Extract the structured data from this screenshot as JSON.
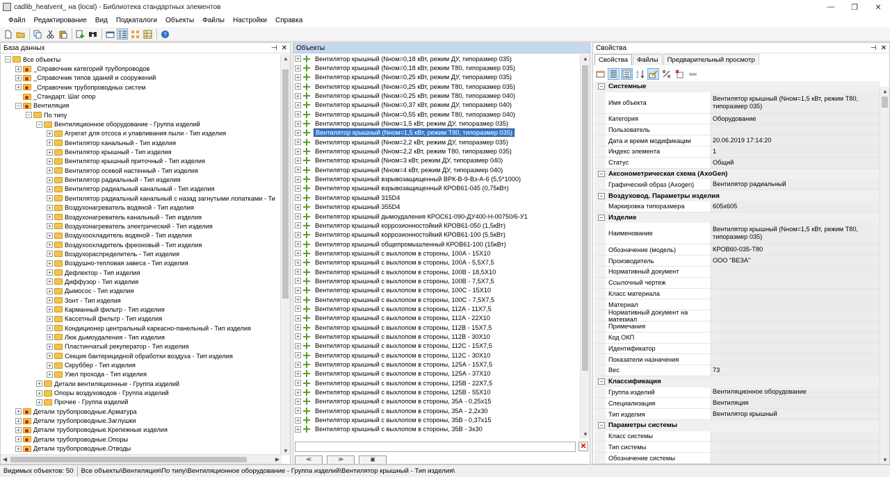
{
  "window": {
    "title": "cadlib_heatvent_ на (local)  - Библиотека стандартных элементов",
    "minimize": "—",
    "maximize": "❐",
    "close": "✕"
  },
  "menu": [
    "Файл",
    "Редактирование",
    "Вид",
    "Подкаталоги",
    "Объекты",
    "Файлы",
    "Настройки",
    "Справка"
  ],
  "database_pane": {
    "title": "База данных",
    "pin": "⊣",
    "close": "✕",
    "tree": [
      {
        "label": "Все объекты",
        "level": 0,
        "exp": "−",
        "cat": false
      },
      {
        "label": "_Справочник категорий трубопроводов",
        "level": 1,
        "exp": "+",
        "cat": true
      },
      {
        "label": "_Справочник типов зданий и сооружений",
        "level": 1,
        "exp": "+",
        "cat": true
      },
      {
        "label": "_Справочник трубопроводных систем",
        "level": 1,
        "exp": "+",
        "cat": true
      },
      {
        "label": "_Стандарт. Шаг опор",
        "level": 1,
        "exp": "",
        "cat": true
      },
      {
        "label": "Вентиляция",
        "level": 1,
        "exp": "−",
        "cat": true
      },
      {
        "label": "По типу",
        "level": 2,
        "exp": "−",
        "cat": false
      },
      {
        "label": "Вентиляционное оборудование - Группа изделий",
        "level": 3,
        "exp": "−",
        "cat": false
      },
      {
        "label": "Агрегат для отсоса и улавливания пыли - Тип изделия",
        "level": 4,
        "exp": "+",
        "cat": false
      },
      {
        "label": "Вентилятор канальный - Тип изделия",
        "level": 4,
        "exp": "+",
        "cat": false
      },
      {
        "label": "Вентилятор крышный - Тип изделия",
        "level": 4,
        "exp": "+",
        "cat": false
      },
      {
        "label": "Вентилятор крышный приточный - Тип изделия",
        "level": 4,
        "exp": "+",
        "cat": false
      },
      {
        "label": "Вентилятор осевой настенный - Тип изделия",
        "level": 4,
        "exp": "+",
        "cat": false
      },
      {
        "label": "Вентилятор радиальный - Тип изделия",
        "level": 4,
        "exp": "+",
        "cat": false
      },
      {
        "label": "Вентилятор радиальный канальный - Тип изделия",
        "level": 4,
        "exp": "+",
        "cat": false
      },
      {
        "label": "Вентилятор радиальный канальный с назад загнутыми лопатками - Ти",
        "level": 4,
        "exp": "+",
        "cat": false
      },
      {
        "label": "Воздухонагреватель водяной - Тип изделия",
        "level": 4,
        "exp": "+",
        "cat": false
      },
      {
        "label": "Воздухонагреватель канальный - Тип изделия",
        "level": 4,
        "exp": "+",
        "cat": false
      },
      {
        "label": "Воздухонагреватель электрический - Тип изделия",
        "level": 4,
        "exp": "+",
        "cat": false
      },
      {
        "label": "Воздухоохладитель водяной - Тип изделия",
        "level": 4,
        "exp": "+",
        "cat": false
      },
      {
        "label": "Воздухоохладитель фреоновый - Тип изделия",
        "level": 4,
        "exp": "+",
        "cat": false
      },
      {
        "label": "Воздухораспределитель - Тип изделия",
        "level": 4,
        "exp": "+",
        "cat": false
      },
      {
        "label": "Воздушно-тепловая завеса - Тип изделия",
        "level": 4,
        "exp": "+",
        "cat": false
      },
      {
        "label": "Дефлектор - Тип изделия",
        "level": 4,
        "exp": "+",
        "cat": false
      },
      {
        "label": "Диффузор - Тип изделия",
        "level": 4,
        "exp": "+",
        "cat": false
      },
      {
        "label": "Дымосос - Тип изделия",
        "level": 4,
        "exp": "+",
        "cat": false
      },
      {
        "label": "Зонт - Тип изделия",
        "level": 4,
        "exp": "+",
        "cat": false
      },
      {
        "label": "Карманный фильтр - Тип изделия",
        "level": 4,
        "exp": "+",
        "cat": false
      },
      {
        "label": "Кассетный фильтр - Тип изделия",
        "level": 4,
        "exp": "+",
        "cat": false
      },
      {
        "label": "Кондиционер центральный каркасно-панельный - Тип изделия",
        "level": 4,
        "exp": "+",
        "cat": false
      },
      {
        "label": "Люк дымоудаления - Тип изделия",
        "level": 4,
        "exp": "+",
        "cat": false
      },
      {
        "label": "Пластинчатый рекуператор - Тип изделия",
        "level": 4,
        "exp": "+",
        "cat": false
      },
      {
        "label": "Секция бактерицидной обработки воздуха - Тип изделия",
        "level": 4,
        "exp": "+",
        "cat": false
      },
      {
        "label": "Скруббер - Тип изделия",
        "level": 4,
        "exp": "+",
        "cat": false
      },
      {
        "label": "Узел прохода - Тип изделия",
        "level": 4,
        "exp": "+",
        "cat": false
      },
      {
        "label": "Детали вентиляционные - Группа изделий",
        "level": 3,
        "exp": "+",
        "cat": false
      },
      {
        "label": "Опоры воздуховодов - Группа изделий",
        "level": 3,
        "exp": "+",
        "cat": false
      },
      {
        "label": "Прочее - Группа изделий",
        "level": 3,
        "exp": "+",
        "cat": false
      },
      {
        "label": "Детали трубопроводные.Арматура",
        "level": 1,
        "exp": "+",
        "cat": true
      },
      {
        "label": "Детали трубопроводные.Заглушки",
        "level": 1,
        "exp": "+",
        "cat": true
      },
      {
        "label": "Детали трубопроводные.Крепежные изделия",
        "level": 1,
        "exp": "+",
        "cat": true
      },
      {
        "label": "Детали трубопроводные.Опоры",
        "level": 1,
        "exp": "+",
        "cat": true
      },
      {
        "label": "Детали трубопроводные.Отводы",
        "level": 1,
        "exp": "+",
        "cat": true
      }
    ]
  },
  "objects_pane": {
    "title": "Объекты",
    "selected_index": 8,
    "items": [
      "Вентилятор крышный (Nном=0,18 кВт, режим ДУ, типоразмер 035)",
      "Вентилятор крышный (Nном=0,18 кВт, режим Т80, типоразмер 035)",
      "Вентилятор крышный (Nном=0,25 кВт, режим ДУ, типоразмер 035)",
      "Вентилятор крышный (Nном=0,25 кВт, режим Т80, типоразмер 035)",
      "Вентилятор крышный (Nном=0,25 кВт, режим Т80, типоразмер 040)",
      "Вентилятор крышный (Nном=0,37 кВт, режим ДУ, типоразмер 040)",
      "Вентилятор крышный (Nном=0,55 кВт, режим Т80, типоразмер 040)",
      "Вентилятор крышный (Nном=1,5 кВт, режим ДУ, типоразмер 035)",
      "Вентилятор крышный (Nном=1,5 кВт, режим Т80, типоразмер 035)",
      "Вентилятор крышный (Nном=2,2 кВт, режим ДУ, типоразмер 035)",
      "Вентилятор крышный (Nном=2,2 кВт, режим Т80, типоразмер 035)",
      "Вентилятор крышный (Nном=3 кВт, режим ДУ, типоразмер 040)",
      "Вентилятор крышный (Nном=4 кВт, режим ДУ, типоразмер 040)",
      "Вентилятор крышный взрывозащищенный ВРК-В-9-Вз-А-6 (5,5*1000)",
      "Вентилятор крышный взрывозащищенный КРОВ61-045 (0,75кВт)",
      "Вентилятор крышный 315D4",
      "Вентилятор крышный 355D4",
      "Вентилятор крышный дымоудаления КРОС61-090-ДУ400-Н-00750/6-У1",
      "Вентилятор крышный коррозионностойкий КРОВ61-050 (1,5кВт)",
      "Вентилятор крышный коррозионностойкий КРОВ61-100 (5,5кВт)",
      "Вентилятор крышный общепромышленный КРОВ61-100 (15кВт)",
      "Вентилятор крышный с выхлопом в стороны, 100А - 15Х10",
      "Вентилятор крышный с выхлопом в стороны, 100А - 5,5Х7,5",
      "Вентилятор крышный с выхлопом в стороны, 100В - 18,5Х10",
      "Вентилятор крышный с выхлопом в стороны, 100В - 7,5Х7,5",
      "Вентилятор крышный с выхлопом в стороны, 100С - 15Х10",
      "Вентилятор крышный с выхлопом в стороны, 100С - 7,5Х7,5",
      "Вентилятор крышный с выхлопом в стороны, 112А - 11Х7,5",
      "Вентилятор крышный с выхлопом в стороны, 112А - 22Х10",
      "Вентилятор крышный с выхлопом в стороны, 112В - 15Х7,5",
      "Вентилятор крышный с выхлопом в стороны, 112В - 30Х10",
      "Вентилятор крышный с выхлопом в стороны, 112С - 15Х7,5",
      "Вентилятор крышный с выхлопом в стороны, 112С - 30Х10",
      "Вентилятор крышный с выхлопом в стороны, 125А - 15Х7,5",
      "Вентилятор крышный с выхлопом в стороны, 125А - 37Х10",
      "Вентилятор крышный с выхлопом в стороны, 125В - 22Х7,5",
      "Вентилятор крышный с выхлопом в стороны, 125В - 55Х10",
      "Вентилятор крышный с выхлопом в стороны, 35А - 0,25х15",
      "Вентилятор крышный с выхлопом в стороны, 35А - 2,2х30",
      "Вентилятор крышный с выхлопом в стороны, 35В - 0,37х15",
      "Вентилятор крышный с выхлопом в стороны, 35В - 3х30"
    ],
    "nav_prev": "≪",
    "nav_next": "≫",
    "nav_extra": "▣"
  },
  "props_pane": {
    "title": "Свойства",
    "tabs": [
      "Свойства",
      "Файлы",
      "Предварительный просмотр"
    ],
    "sections": [
      {
        "title": "Системные",
        "rows": [
          {
            "k": "Имя объекта",
            "v": "Вентилятор крышный (Nном=1,5 кВт, режим Т80, типоразмер 035)",
            "ro": true,
            "tall": true
          },
          {
            "k": "Категория",
            "v": "Оборудование",
            "ro": true
          },
          {
            "k": "Пользователь",
            "v": "",
            "ro": true
          },
          {
            "k": "Дата и время модификации",
            "v": "20.06.2019 17:14:20",
            "ro": true
          },
          {
            "k": "Индекс элемента",
            "v": "1",
            "ro": true
          },
          {
            "k": "Статус",
            "v": "Общий",
            "ro": true
          }
        ]
      },
      {
        "title": "Аксонометрическая схема (AxoGen)",
        "rows": [
          {
            "k": "Графический образ (Axogen)",
            "v": "Вентилятор радиальный",
            "ro": true
          }
        ]
      },
      {
        "title": "Воздуховод. Параметры изделия",
        "rows": [
          {
            "k": "Маркировка типоразмера",
            "v": "605х605",
            "ro": true
          }
        ]
      },
      {
        "title": "Изделие",
        "rows": [
          {
            "k": "Наименование",
            "v": "Вентилятор крышный (Nном=1,5 кВт, режим Т80, типоразмер 035)",
            "ro": true,
            "tall": true
          },
          {
            "k": "Обозначение (модель)",
            "v": "КРОВ60-035-Т80",
            "ro": true
          },
          {
            "k": "Производитель",
            "v": "ООО \"ВЕЗА\"",
            "ro": true
          },
          {
            "k": "Нормативный документ",
            "v": "",
            "ro": true
          },
          {
            "k": "Ссылочный чертеж",
            "v": "",
            "ro": true
          },
          {
            "k": "Класс материала",
            "v": "",
            "ro": true
          },
          {
            "k": "Материал",
            "v": "",
            "ro": true
          },
          {
            "k": "Нормативный документ на материал",
            "v": "",
            "ro": true
          },
          {
            "k": "Примечания",
            "v": "",
            "ro": true
          },
          {
            "k": "Код ОКП",
            "v": "",
            "ro": true
          },
          {
            "k": "Идентификатор",
            "v": "",
            "ro": true
          },
          {
            "k": "Показатели назначения",
            "v": "",
            "ro": true
          },
          {
            "k": "Вес",
            "v": "73",
            "ro": true
          }
        ]
      },
      {
        "title": "Классификация",
        "rows": [
          {
            "k": "Группа изделий",
            "v": "Вентиляционное оборудование",
            "ro": true
          },
          {
            "k": "Специализация",
            "v": "Вентиляция",
            "ro": true
          },
          {
            "k": "Тип изделия",
            "v": "Вентилятор крышный",
            "ro": true
          }
        ]
      },
      {
        "title": "Параметры системы",
        "rows": [
          {
            "k": "Класс системы",
            "v": "",
            "ro": true
          },
          {
            "k": "Тип системы",
            "v": "",
            "ro": true
          },
          {
            "k": "Обозначение системы",
            "v": "",
            "ro": true
          }
        ]
      }
    ]
  },
  "status": {
    "visible_count": "Видимых объектов: 50",
    "path": "Все объекты\\Вентиляция\\По типу\\Вентиляционное оборудование - Группа изделий\\Вентилятор крышный - Тип изделия\\"
  }
}
